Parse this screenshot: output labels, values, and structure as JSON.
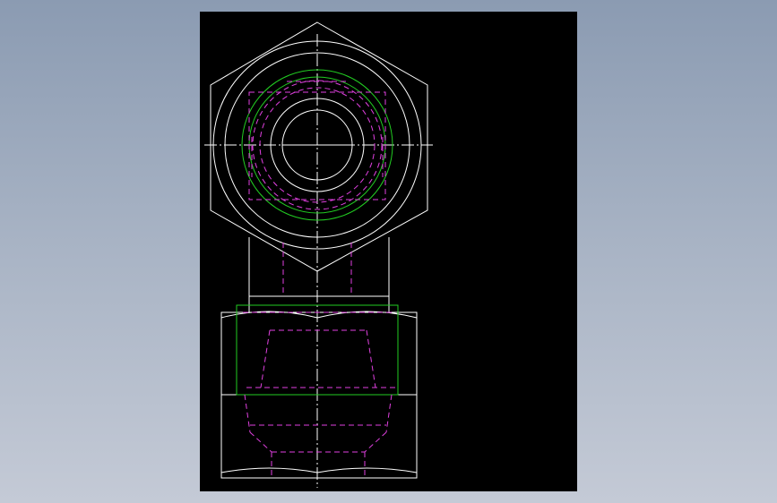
{
  "drawing": {
    "background_color": "#000000",
    "window_gradient": [
      "#8b9bb2",
      "#c4cad6"
    ],
    "line_colors": {
      "visible_edge": "#ffffff",
      "hidden_edge": "#e040e0",
      "thread_outline": "#22cc22",
      "centerline": "#ffffff"
    }
  }
}
